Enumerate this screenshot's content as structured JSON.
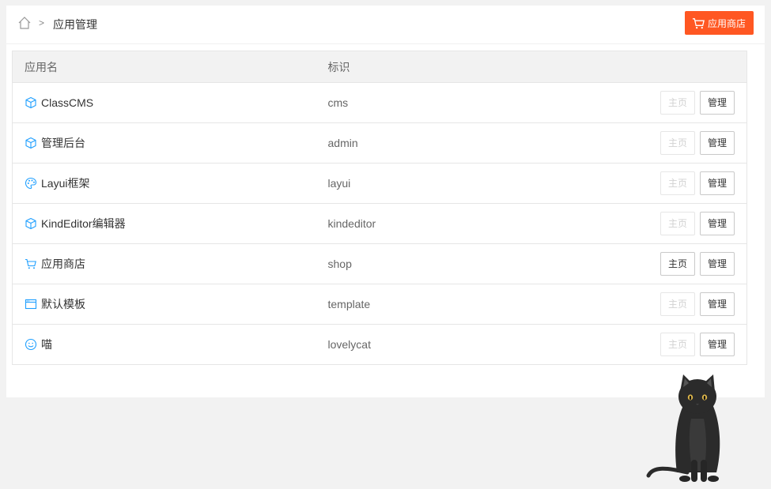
{
  "breadcrumb": {
    "separator": ">",
    "current": "应用管理"
  },
  "header": {
    "shop_button_label": "应用商店"
  },
  "table": {
    "columns": [
      "应用名",
      "标识",
      ""
    ],
    "rows": [
      {
        "name": "ClassCMS",
        "id": "cms",
        "icon": "cube-icon",
        "home": "主页",
        "home_enabled": false,
        "manage": "管理"
      },
      {
        "name": "管理后台",
        "id": "admin",
        "icon": "cube-icon",
        "home": "主页",
        "home_enabled": false,
        "manage": "管理"
      },
      {
        "name": "Layui框架",
        "id": "layui",
        "icon": "palette-icon",
        "home": "主页",
        "home_enabled": false,
        "manage": "管理"
      },
      {
        "name": "KindEditor编辑器",
        "id": "kindeditor",
        "icon": "cube-icon",
        "home": "主页",
        "home_enabled": false,
        "manage": "管理"
      },
      {
        "name": "应用商店",
        "id": "shop",
        "icon": "cart-icon",
        "home": "主页",
        "home_enabled": true,
        "manage": "管理"
      },
      {
        "name": "默认模板",
        "id": "template",
        "icon": "browser-window-icon",
        "home": "主页",
        "home_enabled": false,
        "manage": "管理"
      },
      {
        "name": "喵",
        "id": "lovelycat",
        "icon": "smile-icon",
        "home": "主页",
        "home_enabled": false,
        "manage": "管理"
      }
    ]
  },
  "colors": {
    "accent": "#ff5722",
    "icon_blue": "#1e9fff",
    "cat": "#2b2b2b"
  }
}
